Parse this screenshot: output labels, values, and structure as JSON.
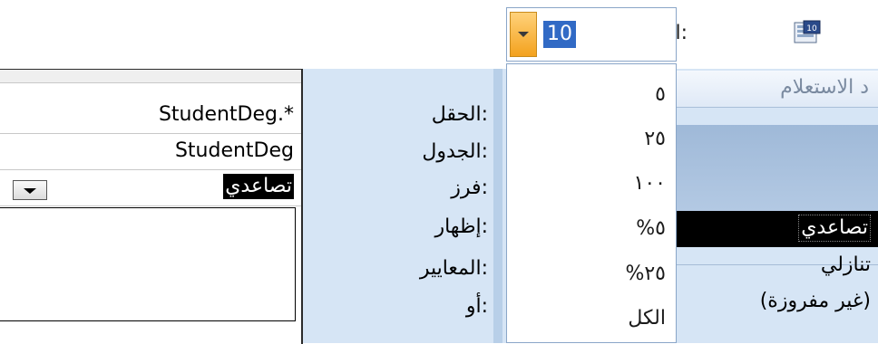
{
  "toolbar": {
    "return_label": "الإرجاع:",
    "return_icon": "top-values-icon",
    "return_value": "10"
  },
  "top_values_menu": {
    "items": [
      "٥",
      "٢٥",
      "١٠٠",
      "%٥",
      "%٢٥",
      "الكل"
    ]
  },
  "query_header": {
    "tab_text": "د الاستعلام"
  },
  "design_grid": {
    "labels": {
      "field": "الحقل:",
      "table": "الجدول:",
      "sort": "فرز:",
      "show": "إظهار:",
      "criteria": "المعايير:",
      "or": "أو:"
    },
    "field_value": "StudentDeg.*",
    "table_value": "StudentDeg",
    "sort_value": "تصاعدي",
    "sort_options": {
      "ascending": "تصاعدي",
      "descending": "تنازلي",
      "not_sorted": "(غير مفروزة)"
    }
  },
  "colors": {
    "panel_blue": "#d6e5f5",
    "selection": "#000000",
    "highlight": "#316ac5",
    "combo_button": "#f3a21e"
  }
}
